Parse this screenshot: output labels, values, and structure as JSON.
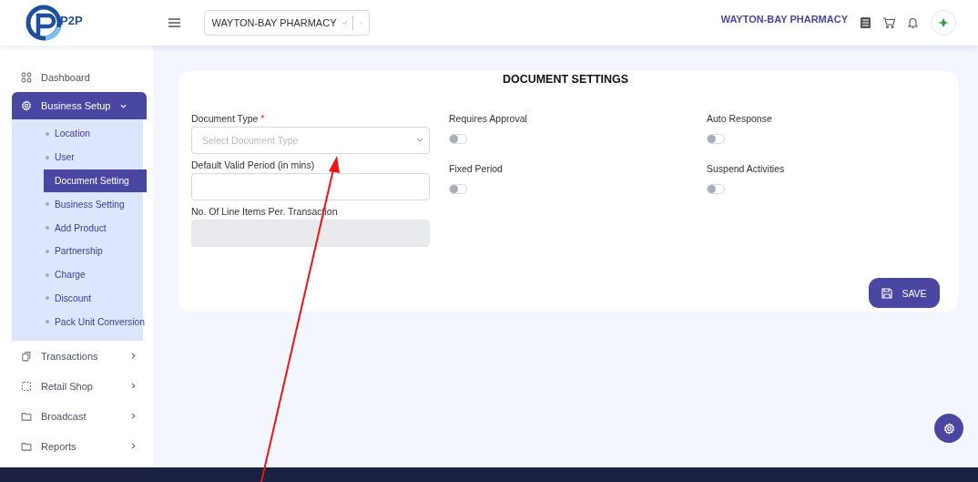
{
  "header": {
    "brand": "P2P",
    "store_select": {
      "value": "WAYTON-BAY PHARMACY"
    },
    "store_name": "WAYTON-BAY PHARMACY"
  },
  "sidebar": {
    "items": [
      {
        "label": "Dashboard",
        "kind": "link",
        "selected": false
      },
      {
        "label": "Business Setup",
        "kind": "group",
        "expanded": true,
        "selected": true,
        "children": [
          {
            "label": "Location",
            "selected": false
          },
          {
            "label": "User",
            "selected": false
          },
          {
            "label": "Document Setting",
            "selected": true
          },
          {
            "label": "Business Setting",
            "selected": false
          },
          {
            "label": "Add Product",
            "selected": false
          },
          {
            "label": "Partnership",
            "selected": false
          },
          {
            "label": "Charge",
            "selected": false
          },
          {
            "label": "Discount",
            "selected": false
          },
          {
            "label": "Pack Unit Conversion",
            "selected": false
          }
        ]
      },
      {
        "label": "Transactions",
        "kind": "group",
        "expanded": false,
        "selected": false
      },
      {
        "label": "Retail Shop",
        "kind": "group",
        "expanded": false,
        "selected": false
      },
      {
        "label": "Broadcast",
        "kind": "group",
        "expanded": false,
        "selected": false
      },
      {
        "label": "Reports",
        "kind": "group",
        "expanded": false,
        "selected": false
      }
    ]
  },
  "card": {
    "title": "DOCUMENT SETTINGS",
    "fields": [
      {
        "kind": "select",
        "label": "Document Type",
        "required_mark": "*",
        "placeholder": "Select Document Type",
        "disabled": false
      },
      {
        "kind": "input",
        "label": "Default Valid Period (in mins)",
        "disabled": false
      },
      {
        "kind": "input",
        "label": "No. Of Line Items Per. Transaction",
        "disabled": true
      }
    ],
    "toggles_middle": [
      {
        "label": "Requires Approval",
        "on": false
      },
      {
        "label": "Fixed Period",
        "on": false
      }
    ],
    "toggles_right": [
      {
        "label": "Auto Response",
        "on": false
      },
      {
        "label": "Suspend Activities",
        "on": false
      }
    ],
    "save_button": "SAVE"
  }
}
